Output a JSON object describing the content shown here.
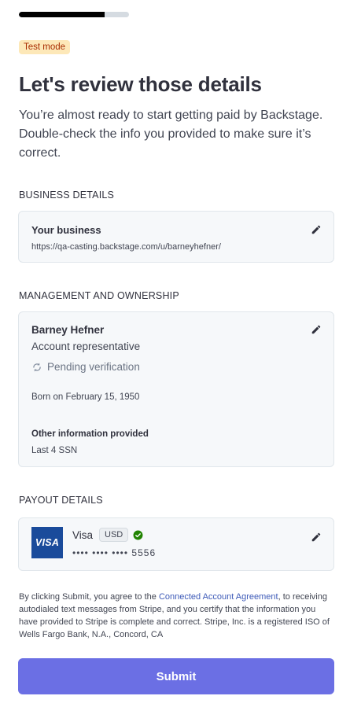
{
  "progress": {
    "fraction": 0.78
  },
  "header": {
    "badge": "Test mode",
    "title": "Let's review those details",
    "subtitle": "You’re almost ready to start getting paid by Backstage. Double-check the info you provided to make sure it’s correct."
  },
  "business": {
    "section_label": "BUSINESS DETAILS",
    "title": "Your business",
    "url": "https://qa-casting.backstage.com/u/barneyhefner/"
  },
  "management": {
    "section_label": "MANAGEMENT AND OWNERSHIP",
    "name": "Barney Hefner",
    "role": "Account representative",
    "status": "Pending verification",
    "born": "Born on February 15, 1950",
    "other_title": "Other information provided",
    "other_value": "Last 4 SSN"
  },
  "payout": {
    "section_label": "PAYOUT DETAILS",
    "logo_text": "VISA",
    "brand": "Visa",
    "currency": "USD",
    "masked_number": "•••• •••• •••• 5556"
  },
  "legal": {
    "prefix": "By clicking Submit, you agree to the ",
    "link": "Connected Account Agreement",
    "suffix": ", to receiving autodialed text messages from Stripe, and you certify that the information you have provided to Stripe is complete and correct. Stripe, Inc. is a registered ISO of Wells Fargo Bank, N.A., Concord, CA"
  },
  "actions": {
    "submit_label": "Submit"
  },
  "colors": {
    "accent": "#6b6fe4",
    "badge_bg": "#fde8b8",
    "badge_text": "#a82c00",
    "verified": "#228403",
    "visa_blue": "#1a4b9b"
  },
  "icons": {
    "edit": "pencil-icon",
    "pending": "sync-icon",
    "verified": "check-circle-icon"
  }
}
